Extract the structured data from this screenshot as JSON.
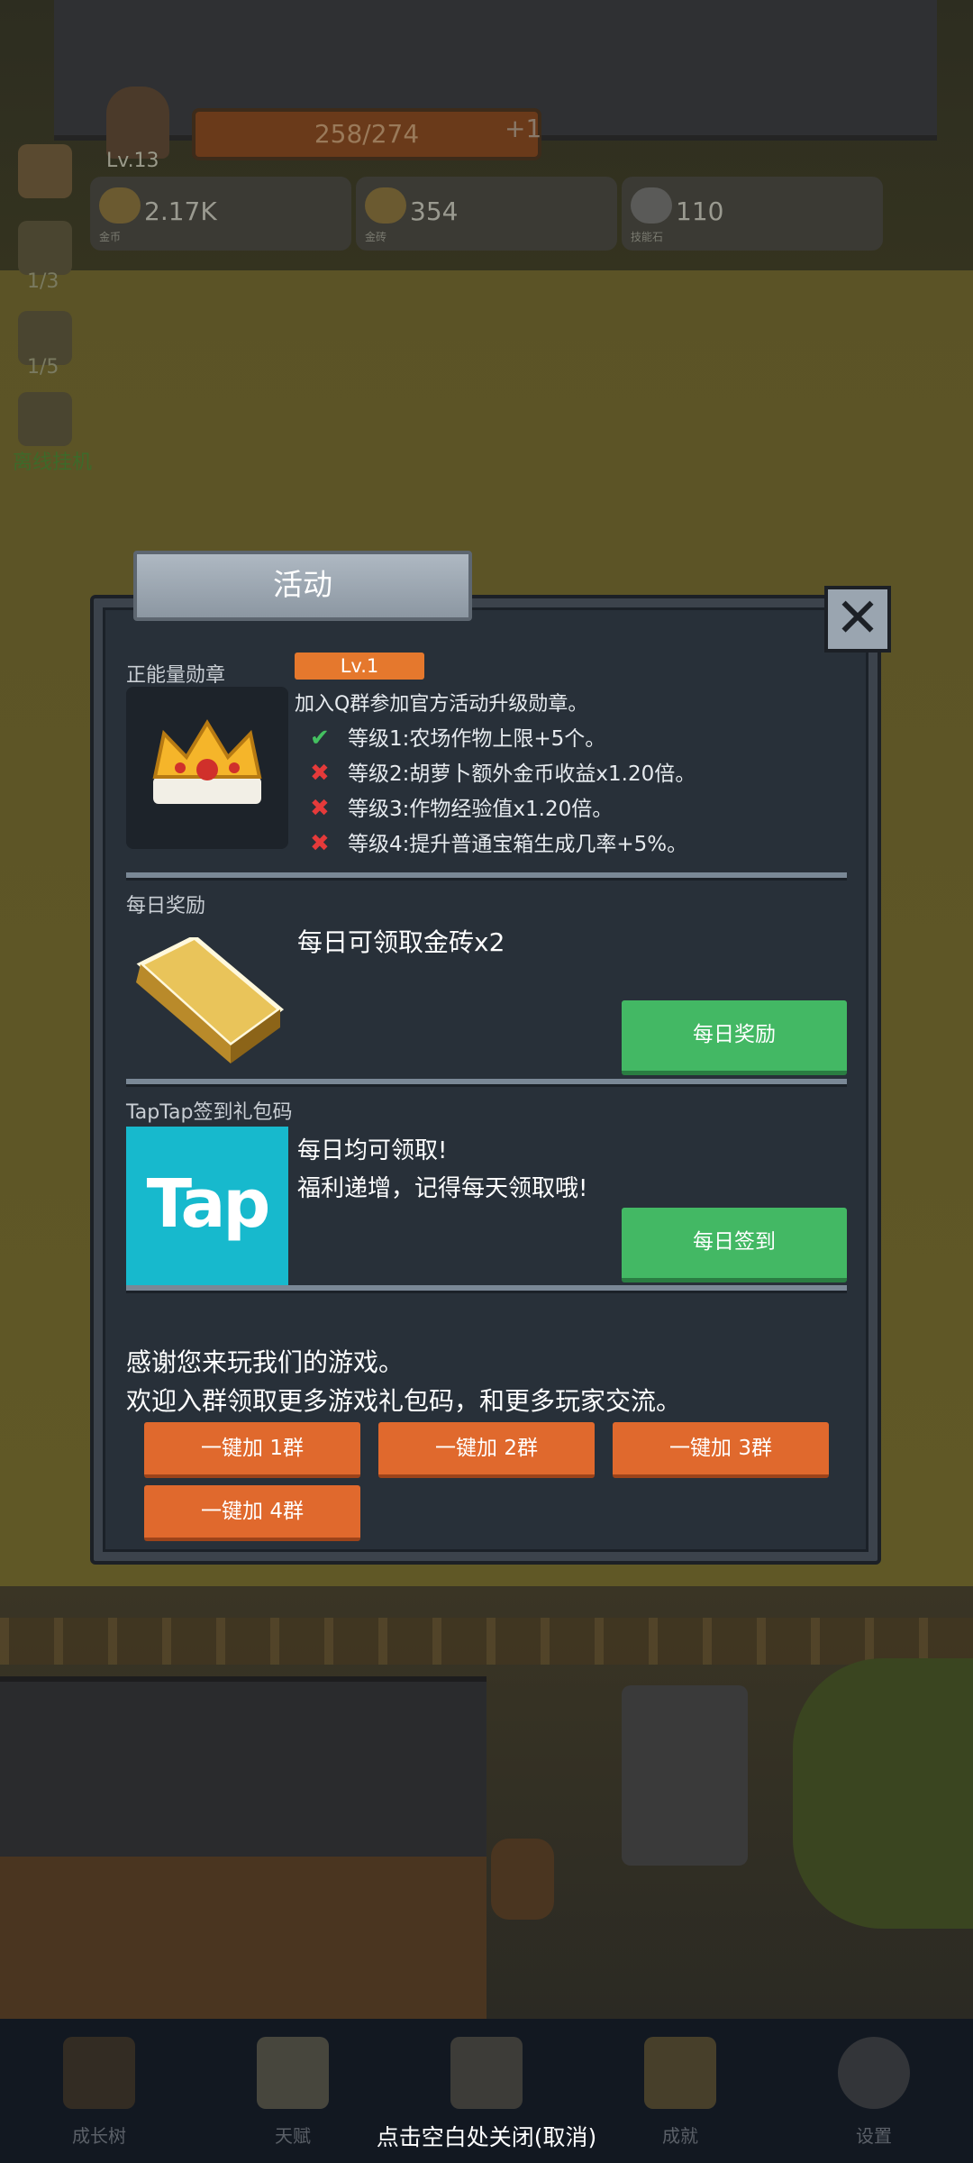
{
  "hud": {
    "level": "Lv.13",
    "exp": "258/274",
    "exp_plus": "+1",
    "resources": [
      {
        "value": "2.17K",
        "caption": "金币",
        "icon": "gold-coin-icon"
      },
      {
        "value": "354",
        "caption": "金砖",
        "icon": "gold-brick-icon"
      },
      {
        "value": "110",
        "caption": "技能石",
        "icon": "skill-stone-icon"
      }
    ],
    "left_counters": [
      "1/3",
      "1/5"
    ],
    "afk_label": "离线挂机"
  },
  "dialog": {
    "title": "活动",
    "close_icon": "close-icon",
    "medal": {
      "label": "正能量勋章",
      "level": "Lv.1",
      "desc": "加入Q群参加官方活动升级勋章。",
      "levels": [
        {
          "mark": "✔",
          "ok": true,
          "text": "等级1:农场作物上限+5个。"
        },
        {
          "mark": "✖",
          "ok": false,
          "text": "等级2:胡萝卜额外金币收益x1.20倍。"
        },
        {
          "mark": "✖",
          "ok": false,
          "text": "等级3:作物经验值x1.20倍。"
        },
        {
          "mark": "✖",
          "ok": false,
          "text": "等级4:提升普通宝箱生成几率+5%。"
        }
      ]
    },
    "daily": {
      "label": "每日奖励",
      "text": "每日可领取金砖x2",
      "button": "每日奖励"
    },
    "taptap": {
      "label": "TapTap签到礼包码",
      "logo": "Tap",
      "line1": "每日均可领取!",
      "line2": "福利递增，记得每天领取哦!",
      "button": "每日签到"
    },
    "thanks": {
      "line1": "感谢您来玩我们的游戏。",
      "line2": "欢迎入群领取更多游戏礼包码，和更多玩家交流。",
      "groups": [
        "一键加 1群",
        "一键加 2群",
        "一键加 3群",
        "一键加 4群"
      ]
    }
  },
  "nav": {
    "items": [
      {
        "label": "成长树",
        "icon": "book-icon"
      },
      {
        "label": "天赋",
        "icon": "scroll-icon"
      },
      {
        "label": "",
        "icon": "map-icon"
      },
      {
        "label": "成就",
        "icon": "key-icon"
      },
      {
        "label": "设置",
        "icon": "gear-icon"
      }
    ],
    "close_hint": "点击空白处关闭(取消)"
  },
  "colors": {
    "panel": "#283039",
    "green": "#43b864",
    "orange": "#e0692d",
    "badge": "#e5782d",
    "tap": "#17b9cd"
  }
}
